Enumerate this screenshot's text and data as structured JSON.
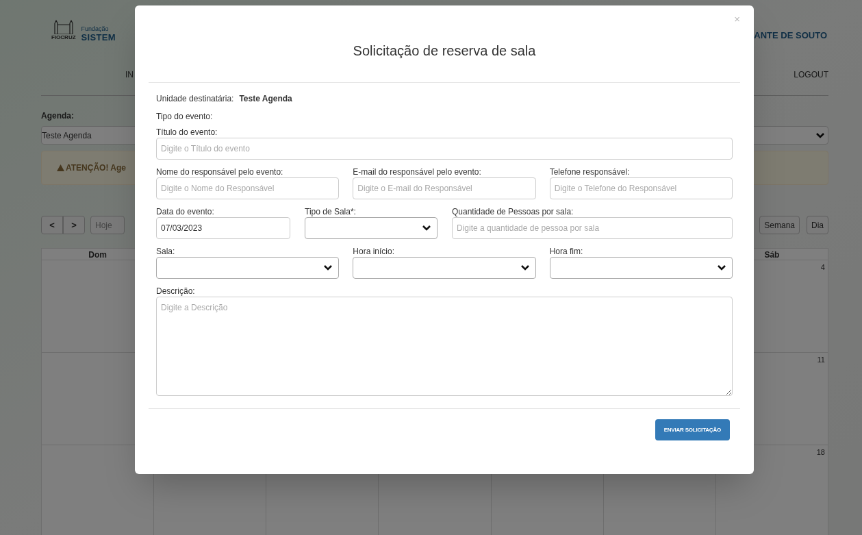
{
  "background": {
    "logo_caption": "FIOCRUZ",
    "org_name": "Fundação",
    "system_name": "SISTEM",
    "user_name": "ANTE DE SOUTO",
    "nav": [
      {
        "label": "IN"
      },
      {
        "label": "LOGOUT"
      }
    ],
    "agenda_label": "Agenda:",
    "agenda_select": "Teste Agenda",
    "alert": "ATENÇÃO! Age",
    "nav_buttons": [
      "<",
      ">"
    ],
    "today_button": "Hoje",
    "view_buttons": [
      "Semana",
      "Dia"
    ],
    "calendar": {
      "first_column": "Dom",
      "last_column": "Sáb",
      "last_column_days": [
        "4",
        "11",
        "18"
      ]
    }
  },
  "modal": {
    "title": "Solicitação de reserva de sala",
    "close": "×",
    "unit_label": "Unidade destinatária:",
    "unit_value": "Teste Agenda",
    "event_type_label": "Tipo do evento:",
    "rows": [
      [
        {
          "kind": "input",
          "label": "Título do evento:",
          "placeholder": "Digite o Título do evento"
        }
      ],
      [
        {
          "kind": "input",
          "label": "Nome do responsável pelo evento:",
          "placeholder": "Digite o Nome do Responsável"
        },
        {
          "kind": "input",
          "label": "E-mail do responsável pelo evento:",
          "placeholder": "Digite o E-mail do Responsável"
        },
        {
          "kind": "input",
          "label": "Telefone responsável:",
          "placeholder": "Digite o Telefone do Responsável"
        }
      ],
      [
        {
          "kind": "input",
          "label": "Data do evento:",
          "value": "07/03/2023"
        },
        {
          "kind": "select",
          "label": "Tipo de Sala*:"
        },
        {
          "kind": "input",
          "label": "Quantidade de Pessoas por sala:",
          "placeholder": "Digite a quantidade de pessoa por sala"
        }
      ],
      [
        {
          "kind": "select",
          "label": "Sala:"
        },
        {
          "kind": "select",
          "label": "Hora início:"
        },
        {
          "kind": "select",
          "label": "Hora fim:"
        }
      ],
      [
        {
          "kind": "textarea",
          "label": "Descrição:",
          "placeholder": "Digite a Descrição"
        }
      ]
    ],
    "submit": "ENVIAR SOLICITAÇÃO"
  }
}
